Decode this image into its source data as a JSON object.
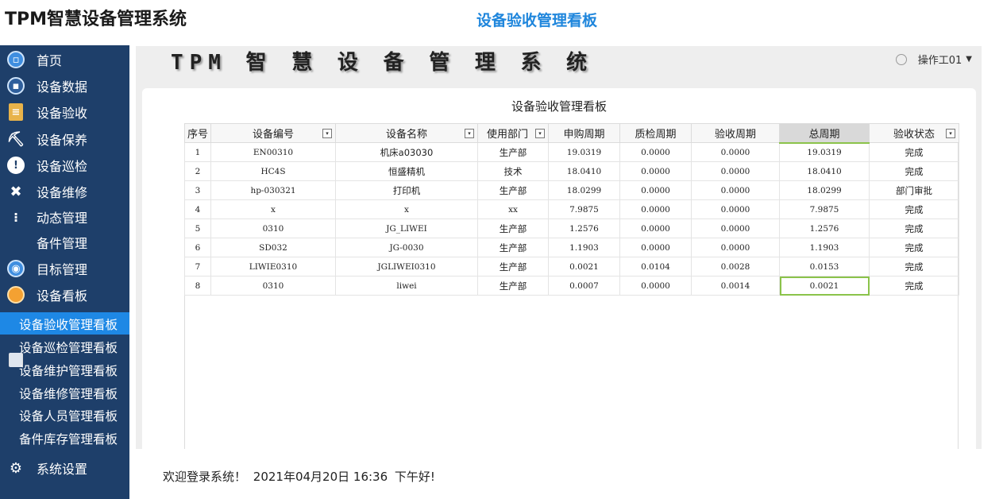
{
  "app": {
    "title": "TPM智慧设备管理系统",
    "page_heading": "设备验收管理看板"
  },
  "sidebar": {
    "items": [
      {
        "label": "首页",
        "icon": "home-icon"
      },
      {
        "label": "设备数据",
        "icon": "data-icon"
      },
      {
        "label": "设备验收",
        "icon": "acceptance-icon"
      },
      {
        "label": "设备保养",
        "icon": "maintenance-icon"
      },
      {
        "label": "设备巡检",
        "icon": "inspection-icon"
      },
      {
        "label": "设备维修",
        "icon": "repair-tools-icon"
      },
      {
        "label": "动态管理",
        "icon": "share-icon"
      },
      {
        "label": "备件管理",
        "icon": "parts-icon"
      },
      {
        "label": "目标管理",
        "icon": "target-icon"
      },
      {
        "label": "设备看板",
        "icon": "dashboard-icon"
      }
    ],
    "sub_items": [
      {
        "label": "设备验收管理看板",
        "active": true
      },
      {
        "label": "设备巡检管理看板",
        "active": false
      },
      {
        "label": "设备维护管理看板",
        "active": false
      },
      {
        "label": "设备维修管理看板",
        "active": false
      },
      {
        "label": "设备人员管理看板",
        "active": false
      },
      {
        "label": "备件库存管理看板",
        "active": false
      }
    ],
    "settings": {
      "label": "系统设置",
      "icon": "gear-icon"
    }
  },
  "topbar": {
    "brand": "TPM 智 慧 设 备 管 理 系 统",
    "user": "操作工01"
  },
  "panel": {
    "title": "设备验收管理看板"
  },
  "table": {
    "columns": [
      "序号",
      "设备编号",
      "设备名称",
      "使用部门",
      "申购周期",
      "质检周期",
      "验收周期",
      "总周期",
      "验收状态"
    ],
    "rows": [
      [
        "1",
        "EN00310",
        "机床a03030",
        "生产部",
        "19.0319",
        "0.0000",
        "0.0000",
        "19.0319",
        "完成"
      ],
      [
        "2",
        "HC4S",
        "恒盛精机",
        "技术",
        "18.0410",
        "0.0000",
        "0.0000",
        "18.0410",
        "完成"
      ],
      [
        "3",
        "hp-030321",
        "打印机",
        "生产部",
        "18.0299",
        "0.0000",
        "0.0000",
        "18.0299",
        "部门审批"
      ],
      [
        "4",
        "x",
        "x",
        "xx",
        "7.9875",
        "0.0000",
        "0.0000",
        "7.9875",
        "完成"
      ],
      [
        "5",
        "0310",
        "JG_LIWEI",
        "生产部",
        "1.2576",
        "0.0000",
        "0.0000",
        "1.2576",
        "完成"
      ],
      [
        "6",
        "SD032",
        "JG-0030",
        "生产部",
        "1.1903",
        "0.0000",
        "0.0000",
        "1.1903",
        "完成"
      ],
      [
        "7",
        "LIWIE0310",
        "JGLIWEI0310",
        "生产部",
        "0.0021",
        "0.0104",
        "0.0028",
        "0.0153",
        "完成"
      ],
      [
        "8",
        "0310",
        "liwei",
        "生产部",
        "0.0007",
        "0.0000",
        "0.0014",
        "0.0021",
        "完成"
      ]
    ]
  },
  "footer": {
    "welcome": "欢迎登录系统！",
    "datetime": "2021年04月20日 16:36",
    "greeting": "下午好!"
  }
}
